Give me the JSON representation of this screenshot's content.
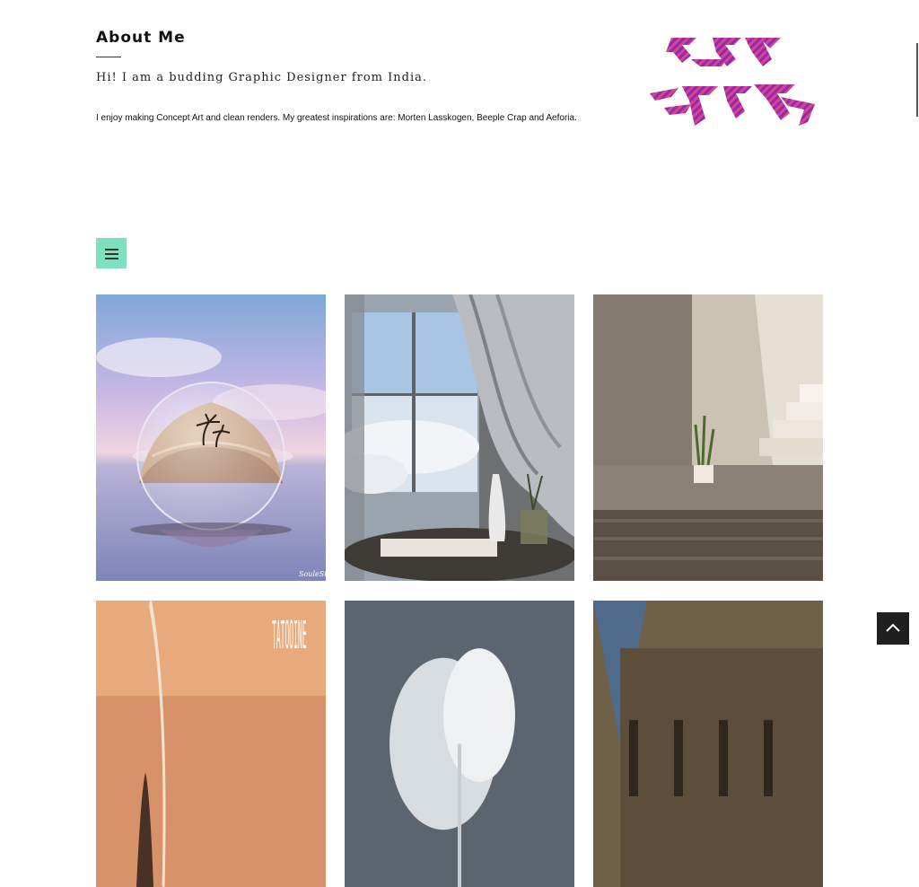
{
  "about": {
    "heading": "About Me",
    "tagline": "Hi! I am a budding Graphic Designer from India.",
    "bio": "I enjoy making Concept Art and clean renders. My greatest inspirations are: Morten Lasskogen, Beeple Crap and Aeforia."
  },
  "colors": {
    "menu_button_bg": "#7ee0bd",
    "scroll_top_bg": "#1f1f1f",
    "logo_primary": "#8a2ac0",
    "logo_secondary": "#e0457a"
  },
  "icons": {
    "menu": "hamburger-icon",
    "scroll_top": "chevron-up-icon"
  },
  "gallery": {
    "tiles": [
      {
        "name": "desert-globe-artwork",
        "watermark": "SouleStayer"
      },
      {
        "name": "window-curtain-artwork"
      },
      {
        "name": "stairs-plant-artwork"
      },
      {
        "name": "tatooine-artwork",
        "watermark": "TATOOINE"
      },
      {
        "name": "clouds-artwork"
      },
      {
        "name": "castle-artwork"
      }
    ]
  }
}
